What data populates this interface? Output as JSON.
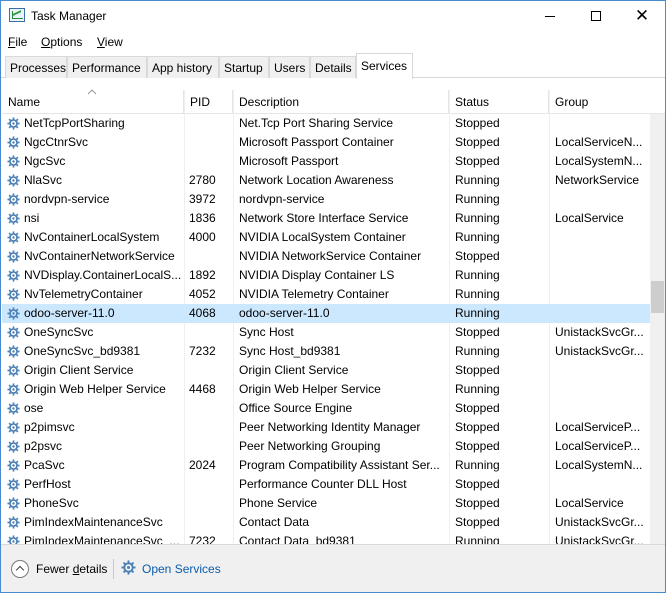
{
  "window": {
    "title": "Task Manager"
  },
  "controls": {
    "minimize": "–",
    "maximize": "□",
    "close": "✕"
  },
  "menu": [
    {
      "label": "File",
      "ul": "F",
      "rest": "ile"
    },
    {
      "label": "Options",
      "ul": "O",
      "rest": "ptions"
    },
    {
      "label": "View",
      "ul": "V",
      "rest": "iew"
    }
  ],
  "tabs": [
    "Processes",
    "Performance",
    "App history",
    "Startup",
    "Users",
    "Details",
    "Services"
  ],
  "active_tab": "Services",
  "columns": {
    "name": "Name",
    "pid": "PID",
    "description": "Description",
    "status": "Status",
    "group": "Group"
  },
  "services": [
    {
      "name": "NetTcpPortSharing",
      "pid": "",
      "description": "Net.Tcp Port Sharing Service",
      "status": "Stopped",
      "group": ""
    },
    {
      "name": "NgcCtnrSvc",
      "pid": "",
      "description": "Microsoft Passport Container",
      "status": "Stopped",
      "group": "LocalServiceN..."
    },
    {
      "name": "NgcSvc",
      "pid": "",
      "description": "Microsoft Passport",
      "status": "Stopped",
      "group": "LocalSystemN..."
    },
    {
      "name": "NlaSvc",
      "pid": "2780",
      "description": "Network Location Awareness",
      "status": "Running",
      "group": "NetworkService"
    },
    {
      "name": "nordvpn-service",
      "pid": "3972",
      "description": "nordvpn-service",
      "status": "Running",
      "group": ""
    },
    {
      "name": "nsi",
      "pid": "1836",
      "description": "Network Store Interface Service",
      "status": "Running",
      "group": "LocalService"
    },
    {
      "name": "NvContainerLocalSystem",
      "pid": "4000",
      "description": "NVIDIA LocalSystem Container",
      "status": "Running",
      "group": ""
    },
    {
      "name": "NvContainerNetworkService",
      "pid": "",
      "description": "NVIDIA NetworkService Container",
      "status": "Stopped",
      "group": ""
    },
    {
      "name": "NVDisplay.ContainerLocalS...",
      "pid": "1892",
      "description": "NVIDIA Display Container LS",
      "status": "Running",
      "group": ""
    },
    {
      "name": "NvTelemetryContainer",
      "pid": "4052",
      "description": "NVIDIA Telemetry Container",
      "status": "Running",
      "group": ""
    },
    {
      "name": "odoo-server-11.0",
      "pid": "4068",
      "description": "odoo-server-11.0",
      "status": "Running",
      "group": "",
      "selected": true
    },
    {
      "name": "OneSyncSvc",
      "pid": "",
      "description": "Sync Host",
      "status": "Stopped",
      "group": "UnistackSvcGr..."
    },
    {
      "name": "OneSyncSvc_bd9381",
      "pid": "7232",
      "description": "Sync Host_bd9381",
      "status": "Running",
      "group": "UnistackSvcGr..."
    },
    {
      "name": "Origin Client Service",
      "pid": "",
      "description": "Origin Client Service",
      "status": "Stopped",
      "group": ""
    },
    {
      "name": "Origin Web Helper Service",
      "pid": "4468",
      "description": "Origin Web Helper Service",
      "status": "Running",
      "group": ""
    },
    {
      "name": "ose",
      "pid": "",
      "description": "Office  Source Engine",
      "status": "Stopped",
      "group": ""
    },
    {
      "name": "p2pimsvc",
      "pid": "",
      "description": "Peer Networking Identity Manager",
      "status": "Stopped",
      "group": "LocalServiceP..."
    },
    {
      "name": "p2psvc",
      "pid": "",
      "description": "Peer Networking Grouping",
      "status": "Stopped",
      "group": "LocalServiceP..."
    },
    {
      "name": "PcaSvc",
      "pid": "2024",
      "description": "Program Compatibility Assistant Ser...",
      "status": "Running",
      "group": "LocalSystemN..."
    },
    {
      "name": "PerfHost",
      "pid": "",
      "description": "Performance Counter DLL Host",
      "status": "Stopped",
      "group": ""
    },
    {
      "name": "PhoneSvc",
      "pid": "",
      "description": "Phone Service",
      "status": "Stopped",
      "group": "LocalService"
    },
    {
      "name": "PimIndexMaintenanceSvc",
      "pid": "",
      "description": "Contact Data",
      "status": "Stopped",
      "group": "UnistackSvcGr..."
    },
    {
      "name": "PimIndexMaintenanceSvc_...",
      "pid": "7232",
      "description": "Contact Data_bd9381",
      "status": "Running",
      "group": "UnistackSvcGr..."
    }
  ],
  "footer": {
    "fewer_details": "Fewer details",
    "fewer_ul": "d",
    "open_services": "Open Services"
  },
  "colors": {
    "selected_row": "#cce8ff",
    "link": "#0b5cad",
    "service_icon": "#4a7fb5"
  }
}
